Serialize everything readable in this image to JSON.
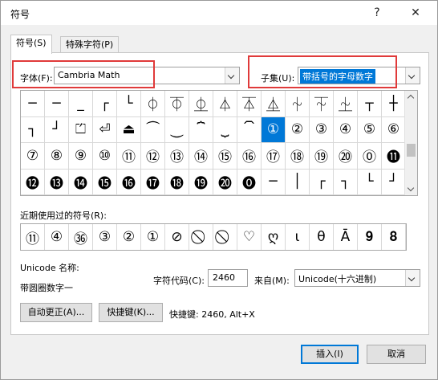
{
  "window": {
    "title": "符号",
    "help_label": "?",
    "close_label": "✕"
  },
  "tabs": [
    {
      "label": "符号(S)"
    },
    {
      "label": "特殊字符(P)"
    }
  ],
  "font": {
    "label": "字体(F):",
    "value": "Cambria Math"
  },
  "subset": {
    "label": "子集(U):",
    "value": "带括号的字母数字"
  },
  "symbol_grid": {
    "rows": [
      [
        "─",
        "─",
        "_",
        "┌",
        "└",
        "⏀",
        "⏁",
        "⏂",
        "⏃",
        "⏄",
        "⏅",
        "⏆",
        "⏇",
        "⏈",
        "┬",
        "┼"
      ],
      [
        "┐",
        "┘",
        "⏍",
        "⏎",
        "⏏",
        "⏜",
        "⏝",
        "⏞",
        "⏟",
        "⏠",
        "①",
        "②",
        "③",
        "④",
        "⑤",
        "⑥"
      ],
      [
        "⑦",
        "⑧",
        "⑨",
        "⑩",
        "⑪",
        "⑫",
        "⑬",
        "⑭",
        "⑮",
        "⑯",
        "⑰",
        "⑱",
        "⑲",
        "⑳",
        "⓪",
        "⓫"
      ],
      [
        "⓬",
        "⓭",
        "⓮",
        "⓯",
        "⓰",
        "⓱",
        "⓲",
        "⓳",
        "⓴",
        "⓿",
        "─",
        "│",
        "┌",
        "┐",
        "└",
        "┘"
      ]
    ],
    "selected": "①"
  },
  "recent": {
    "label": "近期使用过的符号(R):",
    "symbols": [
      "⑪",
      "④",
      "㊱",
      "③",
      "②",
      "①",
      "⊘",
      "⃠",
      "⃠",
      "♡",
      "ღ",
      "ι",
      "θ",
      "Ā",
      "𝟗",
      "𝟖"
    ]
  },
  "unicode": {
    "name_label": "Unicode 名称:",
    "name_value": "带圆圈数字一",
    "code_label": "字符代码(C):",
    "code_value": "2460",
    "from_label": "来自(M):",
    "from_value": "Unicode(十六进制)"
  },
  "buttons": {
    "autocorrect": "自动更正(A)...",
    "shortcut": "快捷键(K)...",
    "shortcut_info": "快捷键: 2460, Alt+X",
    "insert": "插入(I)",
    "cancel": "取消"
  },
  "colors": {
    "highlight_box": "#e03a3a",
    "selection": "#0078d7"
  }
}
